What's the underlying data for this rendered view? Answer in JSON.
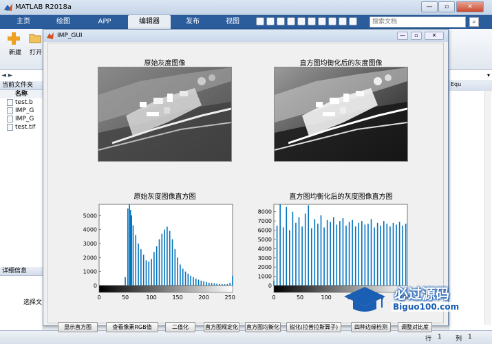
{
  "matlab_window": {
    "title": "MATLAB R2018a",
    "search_placeholder": "搜索文档",
    "tabs": [
      {
        "label": "主页",
        "active": false
      },
      {
        "label": "绘图",
        "active": false
      },
      {
        "label": "APP",
        "active": false
      },
      {
        "label": "编辑器",
        "active": true
      },
      {
        "label": "发布",
        "active": false
      },
      {
        "label": "视图",
        "active": false
      }
    ],
    "ribbon": {
      "new_label": "新建",
      "open_label": "打开"
    },
    "left_panel": {
      "title": "当前文件夹",
      "column_name": "名称",
      "files": [
        "test.b",
        "IMP_G",
        "IMP_G",
        "test.tif"
      ],
      "details_title": "详细信息",
      "select_hint": "选择文"
    },
    "right_panel": {
      "label": "Equ"
    },
    "status": {
      "row_label": "行",
      "row_value": "1",
      "col_label": "列",
      "col_value": "1"
    }
  },
  "gui_window": {
    "title": "IMP_GUI",
    "panels": {
      "orig_image_title": "原始灰度图像",
      "eq_image_title": "直方图均衡化后的灰度图像",
      "orig_hist_title": "原始灰度图像直方图",
      "eq_hist_title": "直方图均衡化后的灰度图像直方图"
    },
    "buttons": [
      "显示直方图",
      "查看像素RGB值",
      "二值化",
      "直方图规定化",
      "直方图均衡化",
      "锐化(拉普拉斯算子)",
      "四种边缘检测",
      "调整对比度"
    ]
  },
  "watermark": {
    "text": "必过源码",
    "url": "Biguo100.com"
  },
  "chart_data": [
    {
      "type": "bar",
      "title": "原始灰度图像直方图",
      "xlim": [
        0,
        255
      ],
      "ylim": [
        0,
        5800
      ],
      "xticks": [
        0,
        50,
        100,
        150,
        200,
        250
      ],
      "yticks": [
        0,
        1000,
        2000,
        3000,
        4000,
        5000
      ],
      "color": "#0072bd",
      "x": [
        50,
        55,
        58,
        60,
        62,
        65,
        70,
        75,
        80,
        85,
        90,
        95,
        100,
        105,
        110,
        115,
        120,
        125,
        130,
        135,
        140,
        145,
        150,
        155,
        160,
        165,
        170,
        175,
        180,
        185,
        190,
        195,
        200,
        205,
        210,
        215,
        220,
        225,
        230,
        235,
        240,
        245,
        250,
        255
      ],
      "values": [
        600,
        5500,
        5800,
        5400,
        5000,
        4300,
        3600,
        3000,
        2600,
        2200,
        1800,
        1700,
        1900,
        2400,
        2800,
        3300,
        3700,
        4000,
        4200,
        3900,
        3300,
        2600,
        2000,
        1500,
        1200,
        1000,
        850,
        700,
        600,
        500,
        420,
        350,
        300,
        250,
        200,
        180,
        150,
        130,
        110,
        100,
        90,
        100,
        200,
        700
      ]
    },
    {
      "type": "bar",
      "title": "直方图均衡化后的灰度图像直方图",
      "xlim": [
        0,
        255
      ],
      "ylim": [
        0,
        8800
      ],
      "xticks": [
        0,
        50,
        100,
        150,
        200,
        250
      ],
      "yticks": [
        0,
        1000,
        2000,
        3000,
        4000,
        5000,
        6000,
        7000,
        8000
      ],
      "color": "#0072bd",
      "x": [
        0,
        6,
        12,
        18,
        24,
        30,
        36,
        42,
        48,
        54,
        60,
        66,
        72,
        78,
        84,
        90,
        96,
        102,
        108,
        114,
        120,
        126,
        132,
        138,
        144,
        150,
        156,
        162,
        168,
        174,
        180,
        186,
        192,
        198,
        204,
        210,
        216,
        222,
        228,
        234,
        240,
        246,
        252
      ],
      "values": [
        500,
        6500,
        8800,
        6300,
        8500,
        6000,
        8000,
        6800,
        7400,
        6400,
        7800,
        8700,
        6200,
        7200,
        6700,
        7600,
        6300,
        7100,
        6900,
        7400,
        6600,
        7000,
        7300,
        6500,
        6900,
        7100,
        6400,
        6800,
        7000,
        6600,
        6700,
        7200,
        6300,
        6800,
        6500,
        7000,
        6700,
        6400,
        6800,
        6600,
        6900,
        6500,
        6700
      ]
    }
  ]
}
